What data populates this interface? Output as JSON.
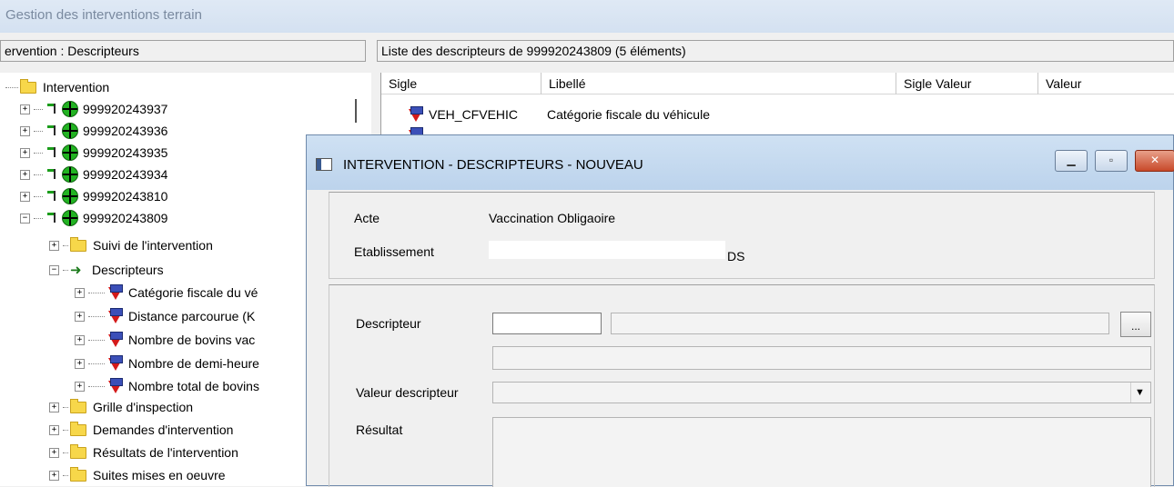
{
  "window": {
    "title": "Gestion des interventions terrain"
  },
  "left_panel": {
    "header": "ervention : Descripteurs",
    "root_label": "Intervention",
    "interventions": [
      "999920243937",
      "999920243936",
      "999920243935",
      "999920243934",
      "999920243810",
      "999920243809"
    ],
    "expanded_children": {
      "suivi": "Suivi de l'intervention",
      "descripteurs": "Descripteurs",
      "descriptor_items": [
        "Catégorie fiscale du vé",
        "Distance parcourue (K",
        "Nombre de bovins vac",
        "Nombre de demi-heure",
        "Nombre total de bovins"
      ],
      "grille": "Grille d'inspection",
      "demandes": "Demandes d'intervention",
      "resultats": "Résultats de l'intervention",
      "suites": "Suites mises en oeuvre"
    }
  },
  "right_panel": {
    "header": "Liste des descripteurs de  999920243809 (5 éléments)",
    "columns": [
      "Sigle",
      "Libellé",
      "Sigle Valeur",
      "Valeur"
    ],
    "rows": [
      {
        "sigle": "VEH_CFVEHIC",
        "libelle": "Catégorie fiscale du véhicule"
      }
    ]
  },
  "dialog": {
    "title": "INTERVENTION - DESCRIPTEURS - NOUVEAU",
    "acte_label": "Acte",
    "acte_value": "Vaccination Obligaoire",
    "etablissement_label": "Etablissement",
    "etablissement_value_suffix": "DS",
    "descripteur_label": "Descripteur",
    "descripteur_code": "",
    "descripteur_libelle": "",
    "browse_label": "...",
    "valeur_label": "Valeur descripteur",
    "valeur_value": "",
    "resultat_label": "Résultat",
    "resultat_value": ""
  }
}
